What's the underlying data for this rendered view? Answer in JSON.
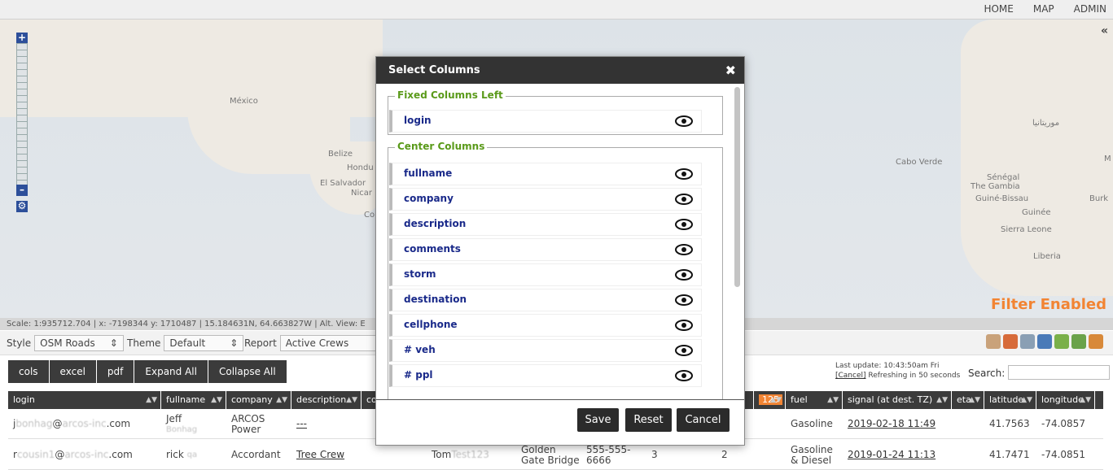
{
  "topnav": {
    "home": "HOME",
    "map": "MAP",
    "admin": "ADMIN"
  },
  "map": {
    "labels": {
      "mexico": "México",
      "belize": "Belize",
      "honduras": "Hondu",
      "el_salvador": "El Salvador",
      "nicaragua": "Nicar",
      "costa_rica": "Co",
      "cabo_verde": "Cabo Verde",
      "senegal": "Sénégal",
      "gambia": "The Gambia",
      "guinea_bissau": "Guiné-Bissau",
      "guinee": "Guinée",
      "sierra_leone": "Sierra Leone",
      "liberia": "Liberia",
      "mauritania": "موريتانيا",
      "burkina": "Burk",
      "mali_edge": "M"
    },
    "collapse_icon": "double-chevron-left-icon",
    "filter_status": "Filter Enabled",
    "scale_text": "Scale: 1:935712.704 | x: -7198344 y: 1710487 | 15.184631N, 64.663827W | Alt. View: E"
  },
  "toolbar": {
    "style_label": "Style",
    "style_value": "OSM Roads",
    "theme_label": "Theme",
    "theme_value": "Default",
    "report_label": "Report",
    "report_value": "Active Crews"
  },
  "buttons": {
    "cols": "cols",
    "excel": "excel",
    "pdf": "pdf",
    "expand_all": "Expand All",
    "collapse_all": "Collapse All"
  },
  "status": {
    "last_update": "Last update: 10:43:50am Fri",
    "cancel": "[Cancel]",
    "refreshing": " Refreshing in 50 seconds",
    "search_label": "Search:"
  },
  "table": {
    "headers": {
      "login": "login",
      "fullname": "fullname",
      "company": "company",
      "description": "description",
      "comments": "co",
      "count": "125",
      "fuel": "fuel",
      "signal": "signal (at dest. TZ)",
      "eta": "eta",
      "latitude": "latitude",
      "longitude": "longitude"
    },
    "rows": [
      {
        "login_a": "j",
        "login_blur": "bonhag",
        "login_b": "@",
        "login_blur2": "arcos-inc",
        "login_c": ".com",
        "fullname_a": "Jeff",
        "fullname_blur": "Bonhag",
        "company": "ARCOS Power",
        "description": "---",
        "fuel": "Gasoline",
        "signal": "2019-02-18 11:49",
        "latitude": "41.7563",
        "longitude": "-74.0857"
      },
      {
        "login_a": "r",
        "login_blur": "cousin1",
        "login_b": "@",
        "login_blur2": "arcos-inc",
        "login_c": ".com",
        "fullname_a": "rick",
        "fullname_blur": "qa",
        "company": "Accordant",
        "description": "Tree Crew",
        "storm_a": "Tom",
        "storm_blur": "Test123",
        "destination": "Golden Gate Bridge",
        "cellphone": "555-555-6666",
        "veh": "3",
        "ppl": "2",
        "fuel": "Gasoline & Diesel",
        "signal": "2019-01-24 11:13",
        "latitude": "41.7471",
        "longitude": "-74.0851"
      }
    ]
  },
  "modal": {
    "title": "Select Columns",
    "close": "✖",
    "fixed_legend": "Fixed Columns Left",
    "fixed_columns": [
      "login"
    ],
    "center_legend": "Center Columns",
    "center_columns": [
      "fullname",
      "company",
      "description",
      "comments",
      "storm",
      "destination",
      "cellphone",
      "# veh",
      "# ppl"
    ],
    "save": "Save",
    "reset": "Reset",
    "cancel": "Cancel"
  },
  "colors": {
    "accent_orange": "#f28433",
    "legend_green": "#5a9a1a",
    "column_blue": "#1a2a8a",
    "dark": "#3b3b3b"
  }
}
